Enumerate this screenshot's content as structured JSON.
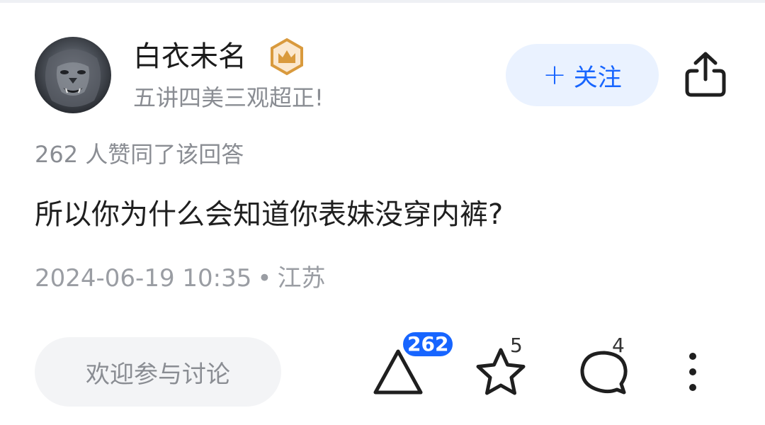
{
  "author": {
    "name": "白衣未名",
    "bio": "五讲四美三观超正!",
    "badge_icon": "crown-badge-icon",
    "avatar_icon": "lion-avatar"
  },
  "actions_top": {
    "follow_label": "关注",
    "follow_icon": "plus-icon",
    "share_icon": "share-icon"
  },
  "answer": {
    "upvote_info": "262 人赞同了该回答",
    "text": "所以你为什么会知道你表妹没穿内裤?",
    "datetime": "2024-06-19 10:35",
    "separator": "•",
    "location": "江苏"
  },
  "bottom_bar": {
    "comment_placeholder": "欢迎参与讨论",
    "upvote_count": "262",
    "favorite_count": "5",
    "comment_count": "4"
  },
  "colors": {
    "accent": "#1765ff",
    "follow_bg": "#eaf2ff",
    "muted_text": "#8a8d93",
    "badge_gold": "#d99a3d"
  }
}
